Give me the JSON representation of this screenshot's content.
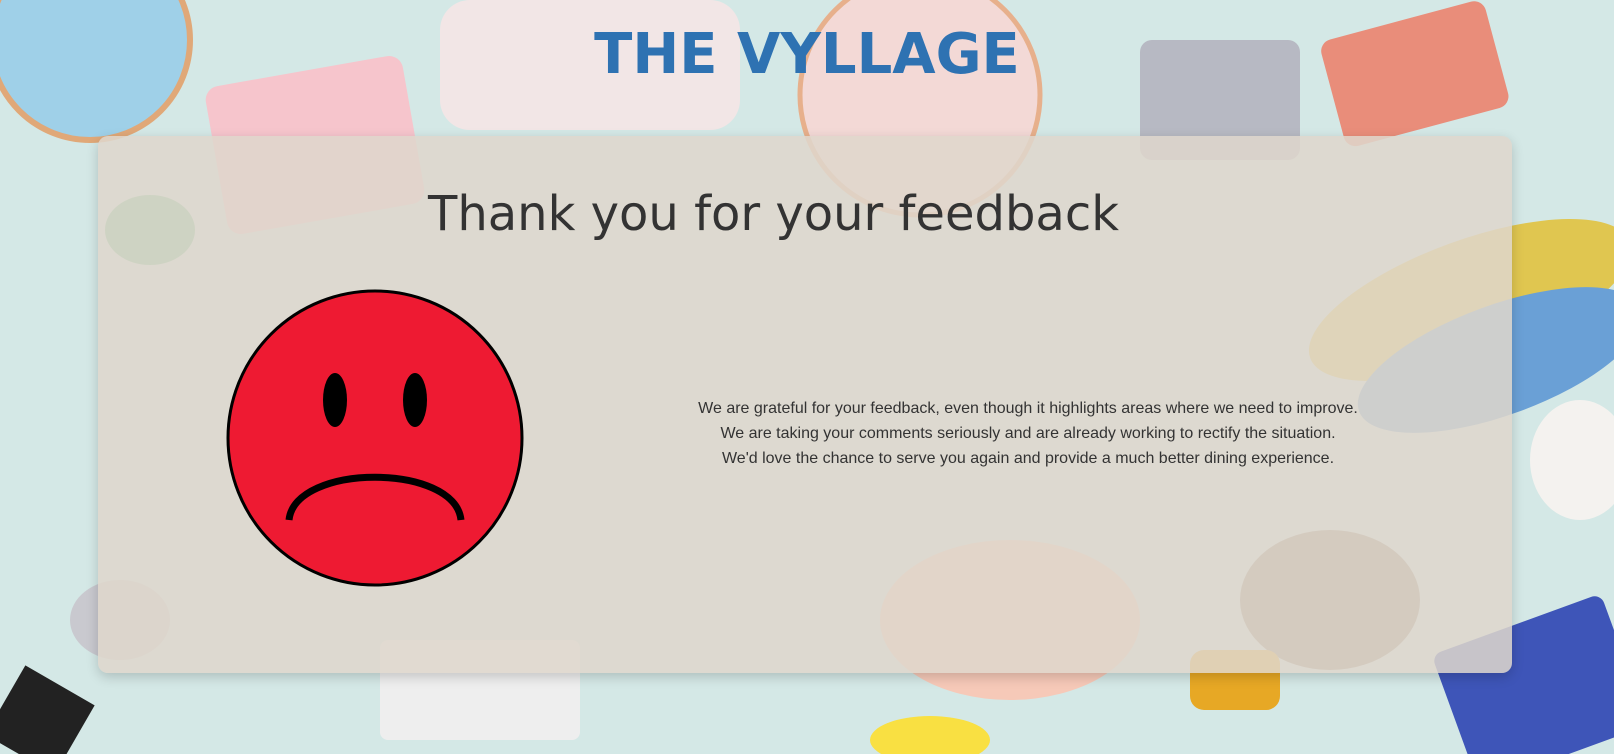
{
  "site": {
    "title": "THE VYLLAGE"
  },
  "card": {
    "heading": "Thank you for your feedback",
    "face_icon": "sad-face-icon",
    "lines": [
      "We are grateful for your feedback, even though it highlights areas where we need to improve.",
      "We are taking your comments seriously and are already working to rectify the situation.",
      "We'd love the chance to serve you again and provide a much better dining experience."
    ]
  },
  "colors": {
    "title": "#2e72b2",
    "face": "#ee1a32",
    "text": "#333333",
    "background": "#d4e8e6"
  }
}
